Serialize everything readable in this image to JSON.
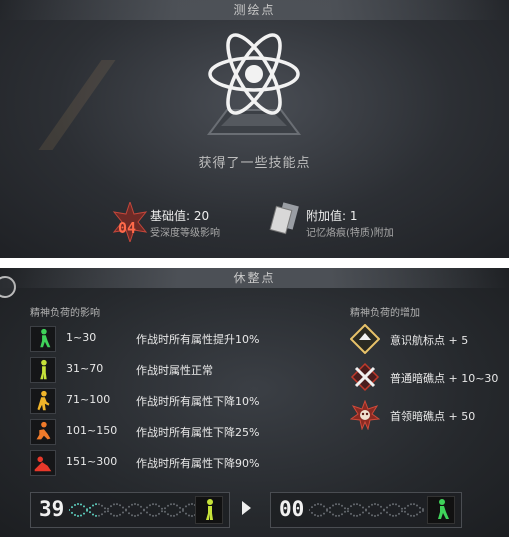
{
  "top_panel": {
    "title": "测绘点",
    "message": "获得了一些技能点",
    "base": {
      "badge_number": "04",
      "label": "基础值: 20",
      "sub": "受深度等级影响"
    },
    "additional": {
      "label": "附加值: 1",
      "sub": "记忆烙痕(特质)附加"
    },
    "icons": [
      "atom-icon",
      "star-badge-icon",
      "cards-icon"
    ]
  },
  "bottom_panel": {
    "title": "休整点",
    "influence_heading": "精神负荷的影响",
    "increase_heading": "精神负荷的增加",
    "rows": [
      {
        "range": "1~30",
        "effect": "作战时所有属性提升10%",
        "color": "#3fd35a"
      },
      {
        "range": "31~70",
        "effect": "作战时属性正常",
        "color": "#c7e33a"
      },
      {
        "range": "71~100",
        "effect": "作战时所有属性下降10%",
        "color": "#f0b52a"
      },
      {
        "range": "101~150",
        "effect": "作战时所有属性下降25%",
        "color": "#f07a2a"
      },
      {
        "range": "151~300",
        "effect": "作战时所有属性下降90%",
        "color": "#e8382a"
      }
    ],
    "increases": [
      {
        "text": "意识航标点 + 5",
        "icon": "beacon-icon"
      },
      {
        "text": "普通暗礁点 + 10~30",
        "icon": "crossed-swords-icon"
      },
      {
        "text": "首领暗礁点 + 50",
        "icon": "boss-skull-icon"
      }
    ],
    "before_value": "39",
    "after_value": "00",
    "before_figure_color": "#c7e33a",
    "after_figure_color": "#3fd35a",
    "dna_color": "#5fd0c0"
  }
}
